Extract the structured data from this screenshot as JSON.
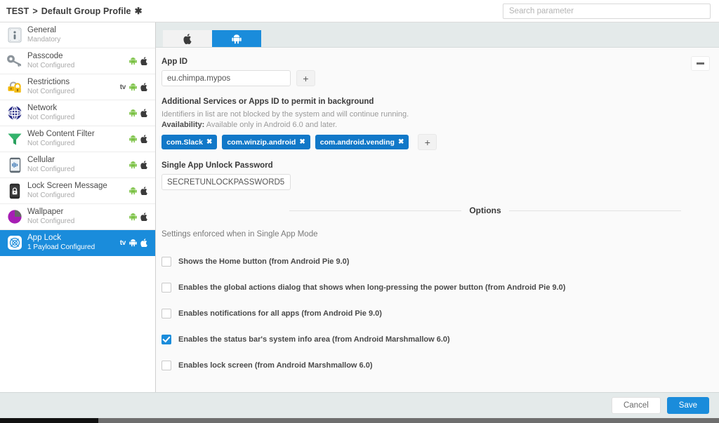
{
  "header": {
    "breadcrumb_prefix": "TEST",
    "breadcrumb_separator": ">",
    "breadcrumb_current": "Default Group Profile",
    "breadcrumb_marker": "✱",
    "breadcrumb_full": "TEST > Default Group Profile ✱"
  },
  "search": {
    "placeholder": "Search parameter",
    "value": ""
  },
  "sidebar": {
    "items": [
      {
        "label": "General",
        "status": "Mandatory",
        "icon": "general-device-icon",
        "badges": [],
        "active": false
      },
      {
        "label": "Passcode",
        "status": "Not Configured",
        "icon": "key-icon",
        "badges": [
          "android",
          "apple"
        ],
        "active": false
      },
      {
        "label": "Restrictions",
        "status": "Not Configured",
        "icon": "lock-restrict-icon",
        "badges": [
          "tv",
          "android",
          "apple"
        ],
        "active": false
      },
      {
        "label": "Network",
        "status": "Not Configured",
        "icon": "globe-network-icon",
        "badges": [
          "android",
          "apple"
        ],
        "active": false
      },
      {
        "label": "Web Content Filter",
        "status": "Not Configured",
        "icon": "funnel-filter-icon",
        "badges": [
          "android",
          "apple"
        ],
        "active": false
      },
      {
        "label": "Cellular",
        "status": "Not Configured",
        "icon": "cellular-phone-icon",
        "badges": [
          "android",
          "apple"
        ],
        "active": false
      },
      {
        "label": "Lock Screen Message",
        "status": "Not Configured",
        "icon": "lock-screen-icon",
        "badges": [
          "android",
          "apple"
        ],
        "active": false
      },
      {
        "label": "Wallpaper",
        "status": "Not Configured",
        "icon": "wallpaper-icon",
        "badges": [
          "android",
          "apple"
        ],
        "active": false
      },
      {
        "label": "App Lock",
        "status": "1 Payload Configured",
        "icon": "app-lock-icon",
        "badges": [
          "tv",
          "android",
          "apple"
        ],
        "active": true
      }
    ]
  },
  "tabs": [
    {
      "name": "ios-tab",
      "icon": "apple-icon",
      "active": false
    },
    {
      "name": "android-tab",
      "icon": "android-icon",
      "active": true
    }
  ],
  "main": {
    "collapse_button_label": "−",
    "app_id": {
      "label": "App ID",
      "value": "eu.chimpa.mypos",
      "placeholder": "",
      "add_button_label": "+"
    },
    "additional_services": {
      "label": "Additional Services or Apps ID to permit in background",
      "hint": "Identifiers in list are not blocked by the system and will continue running.",
      "availability_label": "Availability:",
      "availability_text": "Available only in Android 6.0 and later.",
      "chips": [
        {
          "label": "com.Slack",
          "remove": "✖"
        },
        {
          "label": "com.winzip.android",
          "remove": "✖"
        },
        {
          "label": "com.android.vending",
          "remove": "✖"
        }
      ],
      "add_button_label": "+"
    },
    "unlock_password": {
      "label": "Single App Unlock Password",
      "value": "SECRETUNLOCKPASSWORD5…"
    },
    "options_divider_label": "Options",
    "enforced_note": "Settings enforced when in Single App Mode",
    "checkboxes": [
      {
        "label": "Shows the Home button (from Android Pie 9.0)",
        "checked": false
      },
      {
        "label": "Enables the global actions dialog that shows when long-pressing the power button (from Android Pie 9.0)",
        "checked": false
      },
      {
        "label": "Enables notifications for all apps (from Android Pie 9.0)",
        "checked": false
      },
      {
        "label": "Enables the status bar's system info area (from Android Marshmallow 6.0)",
        "checked": true
      },
      {
        "label": "Enables lock screen (from Android Marshmallow 6.0)",
        "checked": false
      }
    ]
  },
  "footer": {
    "cancel_label": "Cancel",
    "save_label": "Save"
  },
  "colors": {
    "accent_blue": "#1a8cdb",
    "chip_blue": "#1178c8",
    "android_green": "#7ac143",
    "toolbar_gray": "#e4eaea",
    "panel_bg": "#fafafa"
  }
}
